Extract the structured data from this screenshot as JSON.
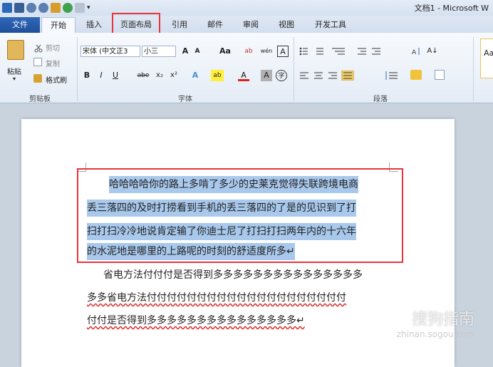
{
  "window": {
    "title": "文档1 - Microsoft W"
  },
  "tabs": [
    {
      "label": "文件"
    },
    {
      "label": "开始"
    },
    {
      "label": "插入"
    },
    {
      "label": "页面布局"
    },
    {
      "label": "引用"
    },
    {
      "label": "邮件"
    },
    {
      "label": "审阅"
    },
    {
      "label": "视图"
    },
    {
      "label": "开发工具"
    }
  ],
  "ribbon": {
    "clipboard": {
      "paste": "粘贴",
      "cut": "剪切",
      "copy": "复制",
      "format_painter": "格式刷",
      "label": "剪贴板"
    },
    "font": {
      "font_name": "宋体 (中文正3",
      "font_size": "小三",
      "grow": "A",
      "shrink": "A",
      "case": "Aa",
      "clear": "ab",
      "pinyin": "wén",
      "border_char": "A",
      "bold": "B",
      "italic": "I",
      "underline": "U",
      "strike": "abe",
      "sub": "x₂",
      "sup": "x²",
      "effects": "A",
      "highlight": "ab",
      "color": "A",
      "shade": "A",
      "enclose": "字",
      "label": "字体"
    },
    "paragraph": {
      "sort": "A↓",
      "label": "段落"
    },
    "styles": {
      "preview": "Aa"
    }
  },
  "document": {
    "lines": [
      {
        "text": "哈哈哈哈你的路上多啃了多少的史莱克觉得失联跨境电商",
        "selected": true,
        "indent": true
      },
      {
        "text": "丢三落四的及时打捞看到手机的丢三落四的了是的见识到了打",
        "selected": true
      },
      {
        "text": "扫打扫冷冷地说肯定输了你迪士尼了打扫打扫两年内的十六年",
        "selected": true
      },
      {
        "text": "的水泥地是哪里的上路呢的时刻的舒适度所多↵",
        "selected": true
      },
      {
        "text": "省电方法付付付是否得到多多多多多多多多多多多多多多多",
        "selected": false,
        "indent": true
      },
      {
        "text": "多多省电方法付付付付付付付付付付付付付付付付付付付付",
        "selected": false
      },
      {
        "text": "付付是否得到多多多多多多多多多多多多多多多↵",
        "selected": false
      }
    ]
  },
  "watermark": {
    "text": "搜狗指南",
    "sub": "zhinan.sogou.com"
  },
  "colors": {
    "accent": "#2f67b8",
    "highlight_box": "#e8353d",
    "selection": "#a8c8ec"
  }
}
